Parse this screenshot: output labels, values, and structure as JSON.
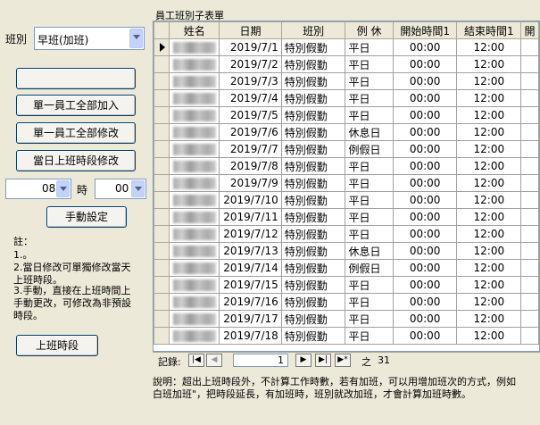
{
  "shift_label": "班別",
  "shift_select": {
    "value": "早班(加班)"
  },
  "buttons": {
    "blank": "",
    "add_all": "單一員工全部加入",
    "modify_all": "單一員工全部修改",
    "day_shift_modify": "當日上班時段修改",
    "manual": "手動設定",
    "work_hours": "上班時段"
  },
  "time": {
    "hour": "08",
    "hour_unit": "時",
    "minute": "00"
  },
  "notes": {
    "title": "註：",
    "line1": "1.。",
    "line2a": "2.當日修改可單獨修改當天",
    "line2b": "上班時段。",
    "line3a": "3.手動，直接在上班時間上",
    "line3b": "手動更改，可修改為非預設",
    "line3c": "時段。"
  },
  "subform_title": "員工班別子表單",
  "table": {
    "columns": [
      "姓名",
      "日期",
      "班別",
      "例 休",
      "開始時間1",
      "結束時間1",
      "開"
    ],
    "rows": [
      [
        "",
        "2019/7/1",
        "特別假勤",
        "平日",
        "00:00",
        "12:00"
      ],
      [
        "",
        "2019/7/2",
        "特別假勤",
        "平日",
        "00:00",
        "12:00"
      ],
      [
        "",
        "2019/7/3",
        "特別假勤",
        "平日",
        "00:00",
        "12:00"
      ],
      [
        "",
        "2019/7/4",
        "特別假勤",
        "平日",
        "00:00",
        "12:00"
      ],
      [
        "",
        "2019/7/5",
        "特別假勤",
        "平日",
        "00:00",
        "12:00"
      ],
      [
        "",
        "2019/7/6",
        "特別假勤",
        "休息日",
        "00:00",
        "12:00"
      ],
      [
        "",
        "2019/7/7",
        "特別假勤",
        "例假日",
        "00:00",
        "12:00"
      ],
      [
        "",
        "2019/7/8",
        "特別假勤",
        "平日",
        "00:00",
        "12:00"
      ],
      [
        "",
        "2019/7/9",
        "特別假勤",
        "平日",
        "00:00",
        "12:00"
      ],
      [
        "",
        "2019/7/10",
        "特別假勤",
        "平日",
        "00:00",
        "12:00"
      ],
      [
        "",
        "2019/7/11",
        "特別假勤",
        "平日",
        "00:00",
        "12:00"
      ],
      [
        "",
        "2019/7/12",
        "特別假勤",
        "平日",
        "00:00",
        "12:00"
      ],
      [
        "",
        "2019/7/13",
        "特別假勤",
        "休息日",
        "00:00",
        "12:00"
      ],
      [
        "",
        "2019/7/14",
        "特別假勤",
        "例假日",
        "00:00",
        "12:00"
      ],
      [
        "",
        "2019/7/15",
        "特別假勤",
        "平日",
        "00:00",
        "12:00"
      ],
      [
        "",
        "2019/7/16",
        "特別假勤",
        "平日",
        "00:00",
        "12:00"
      ],
      [
        "",
        "2019/7/17",
        "特別假勤",
        "平日",
        "00:00",
        "12:00"
      ],
      [
        "",
        "2019/7/18",
        "特別假勤",
        "平日",
        "00:00",
        "12:00"
      ]
    ]
  },
  "record_nav": {
    "label": "記錄:",
    "current": "1",
    "of_label": "之",
    "total": "31"
  },
  "footer": {
    "line1": "說明：超出上班時段外，不計算工作時數，若有加班，可以用增加班次的方式，例如",
    "line2": "白班加班\"，把時段延長，有加班時，班別就改加班，才會計算加班時數。"
  }
}
